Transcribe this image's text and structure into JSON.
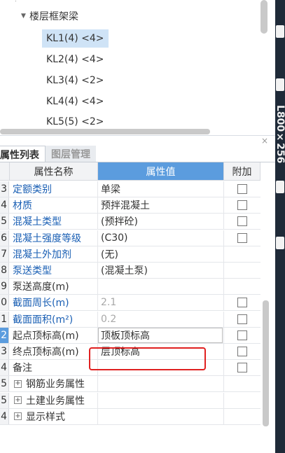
{
  "tree": {
    "group_label": "楼层框架梁",
    "items": [
      {
        "label": "KL1(4) <4>",
        "selected": true
      },
      {
        "label": "KL2(4) <4>",
        "selected": false
      },
      {
        "label": "KL3(4) <2>",
        "selected": false
      },
      {
        "label": "KL4(4) <4>",
        "selected": false
      },
      {
        "label": "KL5(5) <2>",
        "selected": false
      }
    ]
  },
  "right_strip": {
    "vertical_text": "L800×256"
  },
  "panel": {
    "tabs": [
      {
        "label": "属性列表",
        "active": true
      },
      {
        "label": "图层管理",
        "active": false
      }
    ],
    "close_label": "×"
  },
  "table": {
    "headers": {
      "name": "属性名称",
      "value": "属性值",
      "extra": "附加"
    },
    "rows": [
      {
        "num": "3",
        "name": "定额类别",
        "name_color": "blue",
        "value": "单梁",
        "value_color": "black",
        "checkbox": true,
        "expand": false
      },
      {
        "num": "4",
        "name": "材质",
        "name_color": "blue",
        "value": "预拌混凝土",
        "value_color": "black",
        "checkbox": true,
        "expand": false
      },
      {
        "num": "5",
        "name": "混凝土类型",
        "name_color": "blue",
        "value": "(预拌砼)",
        "value_color": "black",
        "checkbox": true,
        "expand": false
      },
      {
        "num": "6",
        "name": "混凝土强度等级",
        "name_color": "blue",
        "value": "(C30)",
        "value_color": "black",
        "checkbox": true,
        "expand": false
      },
      {
        "num": "7",
        "name": "混凝土外加剂",
        "name_color": "blue",
        "value": "(无)",
        "value_color": "black",
        "checkbox": false,
        "expand": false
      },
      {
        "num": "8",
        "name": "泵送类型",
        "name_color": "blue",
        "value": "(混凝土泵)",
        "value_color": "black",
        "checkbox": false,
        "expand": false
      },
      {
        "num": "9",
        "name": "泵送高度(m)",
        "name_color": "black",
        "value": "",
        "value_color": "black",
        "checkbox": false,
        "expand": false
      },
      {
        "num": "0",
        "name": "截面周长(m)",
        "name_color": "blue",
        "value": "2.1",
        "value_color": "gray",
        "checkbox": true,
        "expand": false
      },
      {
        "num": "1",
        "name": "截面面积(m²)",
        "name_color": "blue",
        "value": "0.2",
        "value_color": "gray",
        "checkbox": true,
        "expand": false
      },
      {
        "num": "2",
        "name": "起点顶标高(m)",
        "name_color": "black",
        "value": "顶板顶标高",
        "value_color": "black",
        "checkbox": true,
        "expand": false,
        "selected": true,
        "editing": true
      },
      {
        "num": "3",
        "name": "终点顶标高(m)",
        "name_color": "black",
        "value": "层顶标高",
        "value_color": "black",
        "checkbox": true,
        "expand": false
      },
      {
        "num": "4",
        "name": "备注",
        "name_color": "black",
        "value": "",
        "value_color": "black",
        "checkbox": true,
        "expand": false
      },
      {
        "num": "5",
        "name": "钢筋业务属性",
        "name_color": "black",
        "value": "",
        "value_color": "black",
        "checkbox": false,
        "expand": true
      },
      {
        "num": "5",
        "name": "土建业务属性",
        "name_color": "black",
        "value": "",
        "value_color": "black",
        "checkbox": false,
        "expand": true
      },
      {
        "num": "4",
        "name": "显示样式",
        "name_color": "black",
        "value": "",
        "value_color": "black",
        "checkbox": false,
        "expand": true
      }
    ]
  },
  "colors": {
    "header_accent": "#5b9cde",
    "link_blue": "#1a5fb4",
    "highlight_red": "#e02020",
    "tree_selection": "#cfe3f6",
    "dark_strip": "#1f2a38"
  }
}
